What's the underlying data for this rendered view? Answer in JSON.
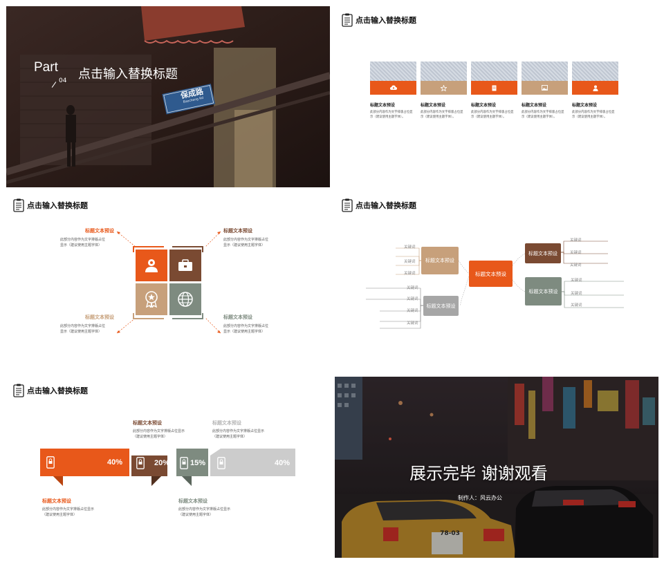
{
  "colors": {
    "orange": "#E8581A",
    "tan": "#C7A07B",
    "brown": "#7A4A32",
    "green_gray": "#7E8B80",
    "gray": "#B5B5B5",
    "light_gray": "#CCCCCC",
    "dark_photo": "#2a1a16"
  },
  "slide1": {
    "part_label": "Part",
    "part_number": "04",
    "title": "点击输入替换标题",
    "sign_text": "保成路",
    "sign_sub": "Baocheng Rd"
  },
  "slide2": {
    "title": "点击输入替换标题",
    "items": [
      {
        "icon": "cloud-upload-icon",
        "header": "标题文本预设",
        "body1": "此部分内容作为文字排版占位显",
        "body2": "示（建议使用主题字体）。"
      },
      {
        "icon": "star-icon",
        "header": "标题文本预设",
        "body1": "此部分内容作为文字排版占位显",
        "body2": "示（建议使用主题字体）。"
      },
      {
        "icon": "document-icon",
        "header": "标题文本预设",
        "body1": "此部分内容作为文字排版占位显",
        "body2": "示（建议使用主题字体）。"
      },
      {
        "icon": "image-icon",
        "header": "标题文本预设",
        "body1": "此部分内容作为文字排版占位显",
        "body2": "示（建议使用主题字体）。"
      },
      {
        "icon": "user-icon",
        "header": "标题文本预设",
        "body1": "此部分内容作为文字排版占位显",
        "body2": "示（建议使用主题字体）。"
      }
    ]
  },
  "slide3": {
    "title": "点击输入替换标题",
    "blocks": [
      {
        "header": "标题文本预设",
        "body1": "此部分内容作为文字排版占位",
        "body2": "显示（建议使用主题字体）"
      },
      {
        "header": "标题文本预设",
        "body1": "此部分内容作为文字排版占位",
        "body2": "显示（建议使用主题字体）"
      },
      {
        "header": "标题文本预设",
        "body1": "此部分内容作为文字排版占位",
        "body2": "显示（建议使用主题字体）"
      },
      {
        "header": "标题文本预设",
        "body1": "此部分内容作为文字排版占位",
        "body2": "显示（建议使用主题字体）"
      }
    ]
  },
  "slide4": {
    "title": "点击输入替换标题",
    "center": "标题文本预设",
    "nodes": [
      "标题文本预设",
      "标题文本预设",
      "标题文本预设",
      "标题文本预设"
    ],
    "keyword": "关键词"
  },
  "slide5": {
    "title": "点击输入替换标题",
    "top_blocks": [
      {
        "header": "标题文本预设",
        "body1": "此部分内容作为文字排版占位显示",
        "body2": "（建议使用主题字体）"
      },
      {
        "header": "标题文本预设",
        "body1": "此部分内容作为文字排版占位显示",
        "body2": "（建议使用主题字体）"
      }
    ],
    "bottom_blocks": [
      {
        "header": "标题文本预设",
        "body1": "此部分内容作为文字排版占位显示",
        "body2": "（建议使用主题字体）"
      },
      {
        "header": "标题文本预设",
        "body1": "此部分内容作为文字排版占位显示",
        "body2": "（建议使用主题字体）"
      }
    ],
    "bars": [
      {
        "pct": "40%"
      },
      {
        "pct": "20%"
      },
      {
        "pct": "15%"
      },
      {
        "pct": "40%"
      }
    ]
  },
  "slide6": {
    "title": "展示完毕 谢谢观看",
    "author": "制作人：风云办公",
    "plate": "78-03"
  }
}
